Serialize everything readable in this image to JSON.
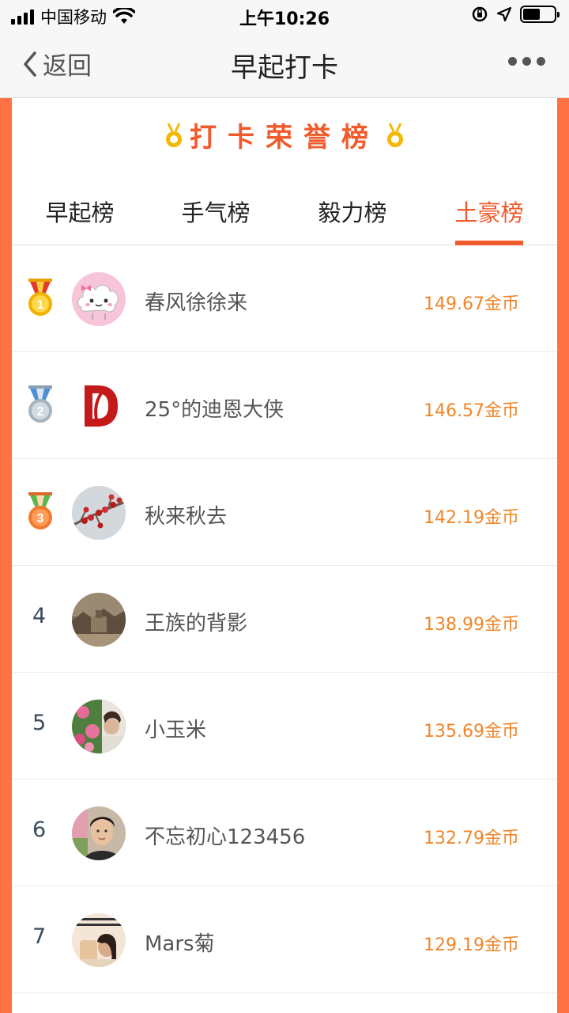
{
  "status_bar": {
    "carrier": "中国移动",
    "time": "上午10:26"
  },
  "nav": {
    "back_label": "返回",
    "title": "早起打卡"
  },
  "board": {
    "title": "打卡荣誉榜"
  },
  "tabs": [
    {
      "label": "早起榜",
      "active": false
    },
    {
      "label": "手气榜",
      "active": false
    },
    {
      "label": "毅力榜",
      "active": false
    },
    {
      "label": "土豪榜",
      "active": true
    }
  ],
  "colors": {
    "accent": "#f15a2b",
    "coins": "#f0862a",
    "frame": "#ff7043"
  },
  "ranking": [
    {
      "rank": "1",
      "medal": "gold",
      "name": "春风徐徐来",
      "coins": "149.67金币",
      "avatar": "cloud-avatar"
    },
    {
      "rank": "2",
      "medal": "silver",
      "name": "25°的迪恩大侠",
      "coins": "146.57金币",
      "avatar": "red-d-logo-avatar"
    },
    {
      "rank": "3",
      "medal": "bronze",
      "name": "秋来秋去",
      "coins": "142.19金币",
      "avatar": "berries-avatar"
    },
    {
      "rank": "4",
      "medal": "",
      "name": "王族的背影",
      "coins": "138.99金币",
      "avatar": "landscape-avatar"
    },
    {
      "rank": "5",
      "medal": "",
      "name": "小玉米",
      "coins": "135.69金币",
      "avatar": "flowers-avatar"
    },
    {
      "rank": "6",
      "medal": "",
      "name": "不忘初心123456",
      "coins": "132.79金币",
      "avatar": "man-photo-avatar"
    },
    {
      "rank": "7",
      "medal": "",
      "name": "Mars菊",
      "coins": "129.19金币",
      "avatar": "girl-photo-avatar"
    }
  ]
}
